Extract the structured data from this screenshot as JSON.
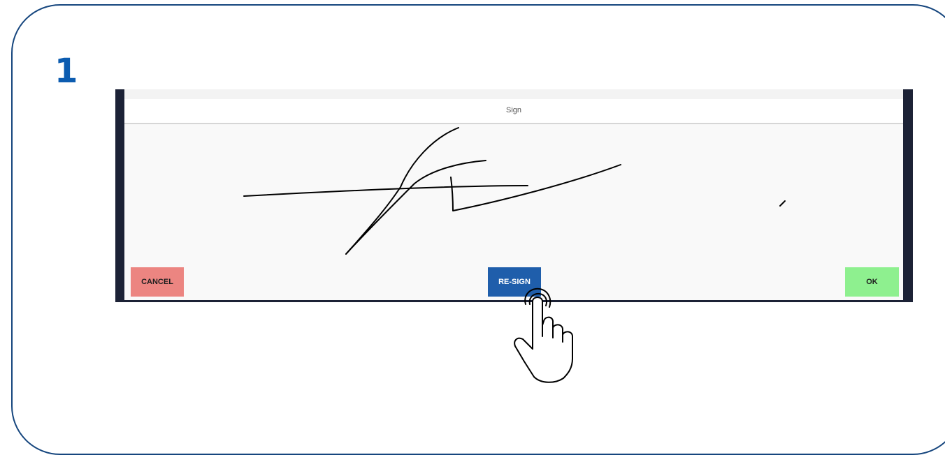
{
  "step": {
    "number": "1"
  },
  "dialog": {
    "title": "Sign"
  },
  "buttons": {
    "cancel_label": "CANCEL",
    "resign_label": "RE-SIGN",
    "ok_label": "OK"
  },
  "colors": {
    "frame_border": "#16467e",
    "step_number": "#0c5cb0",
    "cancel_bg": "#ec8581",
    "resign_bg": "#1f5eab",
    "ok_bg": "#8ef08f"
  },
  "icons": {
    "pointer": "tap-hand-icon"
  }
}
